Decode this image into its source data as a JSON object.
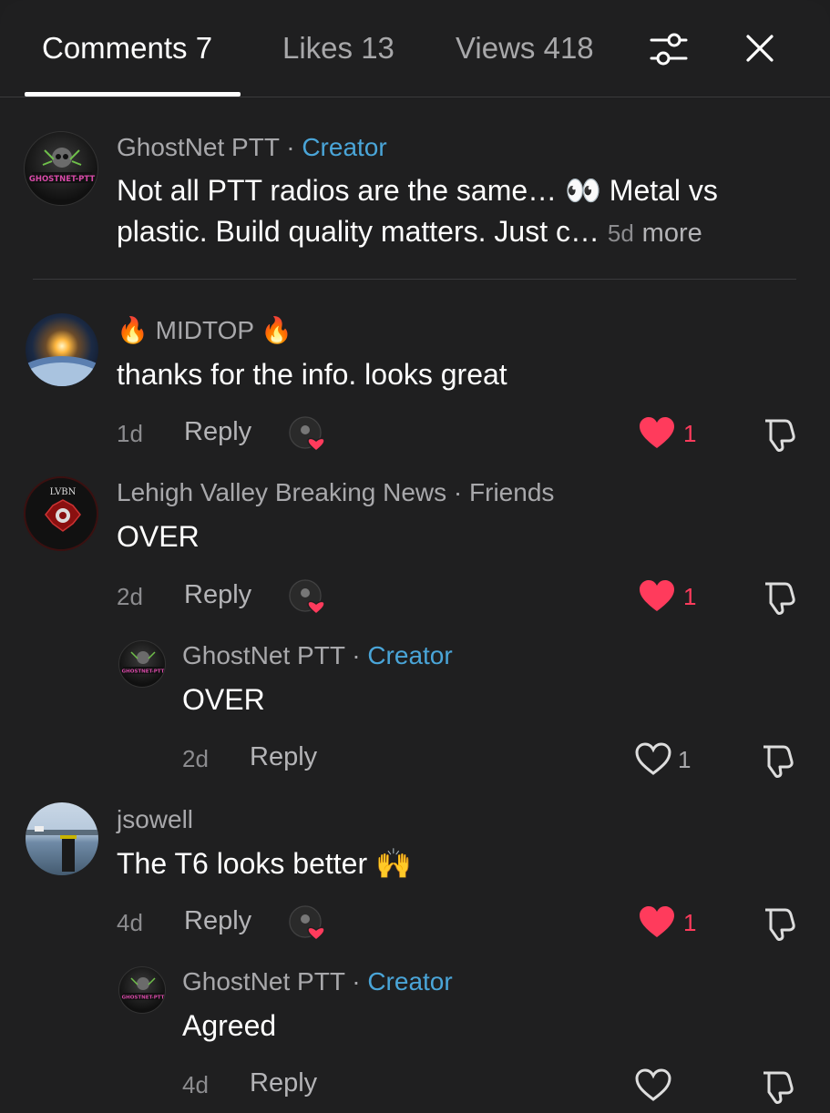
{
  "tabs": [
    {
      "label": "Comments 7"
    },
    {
      "label": "Likes 13"
    },
    {
      "label": "Views 418"
    }
  ],
  "pinned": {
    "author": "GhostNet PTT",
    "dot": " · ",
    "badge": "Creator",
    "avatar_text": "GHOSTNET-PTT",
    "line1": "Not all PTT radios are the same… 👀 Metal vs",
    "line2": "plastic. Build quality matters. Just c…",
    "time": "5d",
    "more": "more"
  },
  "comments": [
    {
      "author": "🔥 MIDTOP 🔥",
      "text": "thanks for the info. looks great",
      "time": "1d",
      "reply": "Reply",
      "likes": "1"
    },
    {
      "author": "Lehigh Valley Breaking News",
      "dot": " · ",
      "badge": "Friends",
      "avatar_text": "LVBN",
      "text": "OVER",
      "time": "2d",
      "reply": "Reply",
      "likes": "1",
      "reply_item": {
        "author": "GhostNet PTT",
        "dot": " · ",
        "badge": "Creator",
        "avatar_text": "GHOSTNET-PTT",
        "text": "OVER",
        "time": "2d",
        "reply": "Reply",
        "likes": "1"
      }
    },
    {
      "author": "jsowell",
      "text": "The T6 looks better 🙌",
      "time": "4d",
      "reply": "Reply",
      "likes": "1",
      "reply_item": {
        "author": "GhostNet PTT",
        "dot": " · ",
        "badge": "Creator",
        "avatar_text": "GHOSTNET-PTT",
        "text": "Agreed",
        "time": "4d",
        "reply": "Reply"
      }
    }
  ],
  "colors": {
    "background": "#1f1f20",
    "creator_badge": "#4aa5d8",
    "liked_heart": "#ff3b5c",
    "secondary_text": "#a8a8ab"
  },
  "icons": [
    "filter-icon",
    "close-icon",
    "heart-filled-icon",
    "heart-outline-icon",
    "dislike-icon"
  ]
}
